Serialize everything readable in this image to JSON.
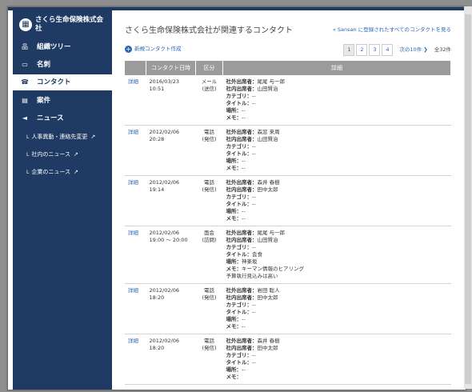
{
  "sidebar": {
    "company": "さくら生命保険株式会社",
    "items": [
      {
        "label": "組織ツリー",
        "icon": "org-tree-icon",
        "active": false
      },
      {
        "label": "名刺",
        "icon": "card-icon",
        "active": false
      },
      {
        "label": "コンタクト",
        "icon": "contact-icon",
        "active": true
      },
      {
        "label": "案件",
        "icon": "project-icon",
        "active": false
      },
      {
        "label": "ニュース",
        "icon": "megaphone-icon",
        "active": false
      }
    ],
    "subitems": [
      {
        "label": "人事異動・連絡先変更"
      },
      {
        "label": "社内のニュース"
      },
      {
        "label": "企業のニュース"
      }
    ]
  },
  "main": {
    "title": "さくら生命保険株式会社が関連するコンタクト",
    "all_link": "« Sansan に登録されたすべてのコンタクトを見る",
    "new_contact": "新規コンタクト作成",
    "pager": {
      "pages": [
        "1",
        "2",
        "3",
        "4"
      ],
      "current": "1",
      "next": "次の10件 ❯",
      "total": "全32件"
    },
    "table": {
      "headers": [
        "",
        "コンタクト日時",
        "区分",
        "詳細"
      ],
      "rows": [
        {
          "link": "詳細",
          "date": "2016/03/23",
          "time": "10:51",
          "kind1": "メール",
          "kind2": "(送信)",
          "ext": "尾尾 与一郎",
          "int": "山田賢治",
          "cat": "--",
          "title": "--",
          "place": "--",
          "memo": "--",
          "extra": ""
        },
        {
          "link": "詳細",
          "date": "2012/02/06",
          "time": "20:28",
          "kind1": "電話",
          "kind2": "(発信)",
          "ext": "森窓 来周",
          "int": "山田賢治",
          "cat": "--",
          "title": "--",
          "place": "--",
          "memo": "--",
          "extra": ""
        },
        {
          "link": "詳細",
          "date": "2012/02/06",
          "time": "19:14",
          "kind1": "電話",
          "kind2": "(発信)",
          "ext": "森井 春樹",
          "int": "田中太郎",
          "cat": "--",
          "title": "--",
          "place": "--",
          "memo": "--",
          "extra": ""
        },
        {
          "link": "詳細",
          "date": "2012/02/06",
          "time": "19:00 ～ 20:00",
          "kind1": "面会",
          "kind2": "(訪問)",
          "ext": "尾尾 与一郎",
          "int": "山田賢治",
          "cat": "--",
          "title": "会食",
          "place": "神楽坂",
          "memo": "キーマン情報のヒアリング",
          "extra": "予算執行見込みは高い"
        },
        {
          "link": "詳細",
          "date": "2012/02/06",
          "time": "18:20",
          "kind1": "電話",
          "kind2": "(発信)",
          "ext": "岩田 聡人",
          "int": "田中太郎",
          "cat": "--",
          "title": "--",
          "place": "--",
          "memo": "--",
          "extra": ""
        },
        {
          "link": "詳細",
          "date": "2012/02/06",
          "time": "18:20",
          "kind1": "電話",
          "kind2": "(発信)",
          "ext": "森井 春樹",
          "int": "田中太郎",
          "cat": "--",
          "title": "--",
          "place": "--",
          "memo": "",
          "extra": ""
        }
      ]
    },
    "labels": {
      "ext": "社外出席者：",
      "int": "社内出席者：",
      "cat": "カテゴリ：",
      "title": "タイトル：",
      "place": "場所：",
      "memo": "メモ："
    }
  }
}
